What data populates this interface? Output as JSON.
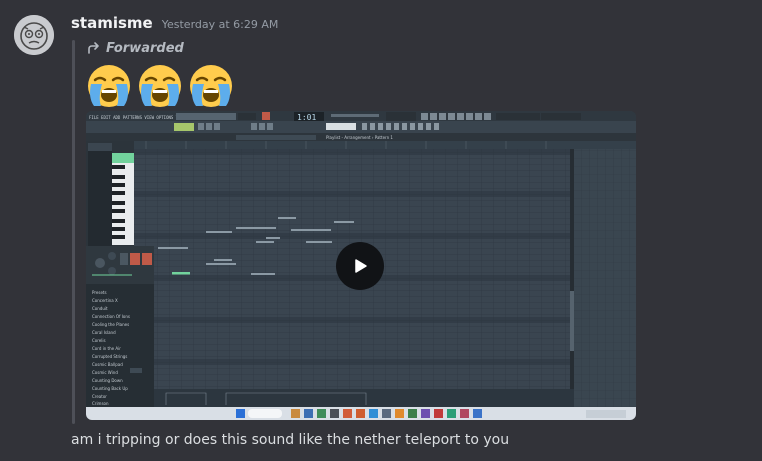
{
  "message": {
    "username": "stamisme",
    "timestamp": "Yesterday at 6:29 AM",
    "forwarded_label": "Forwarded",
    "emojis": [
      "loudly-crying-face",
      "loudly-crying-face",
      "loudly-crying-face"
    ],
    "text": "am i tripping or does this sound like the nether teleport to you"
  },
  "video": {
    "app": "FL Studio",
    "time_display": "1:01",
    "window_title": "Playlist - Arrangement › Pattern 1",
    "browser_items": [
      "Presets",
      "Concertina X",
      "Conduit",
      "Connection Of Ions",
      "Cooling the Planes",
      "Coral Island",
      "Corelis",
      "Cord in the Air",
      "Corrupted Strings",
      "Cosmic Ballpad",
      "Cosmic Wind",
      "Counting Down",
      "Counting Back Up",
      "Creator",
      "Crimson"
    ],
    "play_icon": "play-icon"
  },
  "colors": {
    "background": "#323339",
    "username": "#f2f3f5",
    "muted": "#949ba4",
    "accent_green": "#72d39d"
  }
}
